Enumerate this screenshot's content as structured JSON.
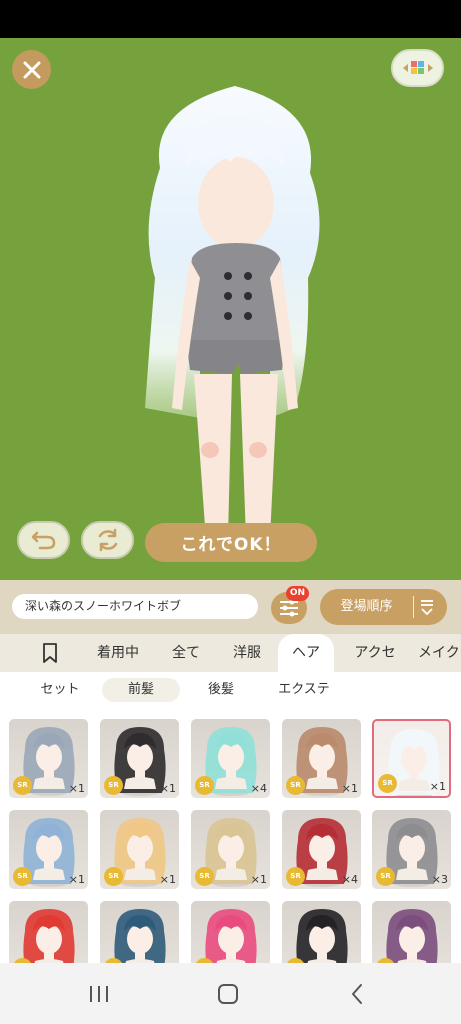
{
  "outfit_name": "深い森のスノーホワイトボブ",
  "ok_label": "これでOK！",
  "filter_badge": "ON",
  "sort_label": "登場順序",
  "tabs": [
    {
      "label": ""
    },
    {
      "label": "着用中"
    },
    {
      "label": "全て"
    },
    {
      "label": "洋服"
    },
    {
      "label": "ヘア"
    },
    {
      "label": "アクセ"
    },
    {
      "label": "メイク"
    }
  ],
  "subtabs": [
    {
      "label": "セット"
    },
    {
      "label": "前髪"
    },
    {
      "label": "後髪"
    },
    {
      "label": "エクステ"
    }
  ],
  "items": [
    {
      "rarity": "SR",
      "count": "×1",
      "hair_color": "#9aa7b8"
    },
    {
      "rarity": "SR",
      "count": "×1",
      "hair_color": "#2f2b2e"
    },
    {
      "rarity": "SR",
      "count": "×4",
      "hair_color": "#8fe0d8"
    },
    {
      "rarity": "SR",
      "count": "×1",
      "hair_color": "#b98a6c"
    },
    {
      "rarity": "SR",
      "count": "×1",
      "hair_color": "#f2f7fb"
    },
    {
      "rarity": "SR",
      "count": "×1",
      "hair_color": "#8fb2d6"
    },
    {
      "rarity": "SR",
      "count": "×1",
      "hair_color": "#f0c784"
    },
    {
      "rarity": "SR",
      "count": "×1",
      "hair_color": "#d8c494"
    },
    {
      "rarity": "SR",
      "count": "×4",
      "hair_color": "#b52d35"
    },
    {
      "rarity": "SR",
      "count": "×3",
      "hair_color": "#8d8d90"
    },
    {
      "rarity": "SR",
      "count": "",
      "hair_color": "#e03a32"
    },
    {
      "rarity": "SR",
      "count": "",
      "hair_color": "#2f5b7a"
    },
    {
      "rarity": "SR",
      "count": "",
      "hair_color": "#e94b7e"
    },
    {
      "rarity": "SR",
      "count": "",
      "hair_color": "#242226"
    },
    {
      "rarity": "SR",
      "count": "",
      "hair_color": "#7b4e7d"
    }
  ],
  "selected_index": 4,
  "colors": {
    "stage_bg": "#75a23c",
    "accent_gold": "#c9a064",
    "selected_border": "#e06c7c",
    "rarity_badge": "#e8b933",
    "on_badge": "#e8412e"
  },
  "icons": {
    "close": "close-icon",
    "layout": "layout-toggle-icon",
    "undo": "undo-icon",
    "reset": "refresh-icon",
    "filter": "sliders-icon",
    "sort": "sort-icon",
    "bookmark": "bookmark-icon",
    "nav_recent": "recent-apps-icon",
    "nav_home": "home-icon",
    "nav_back": "back-icon"
  }
}
